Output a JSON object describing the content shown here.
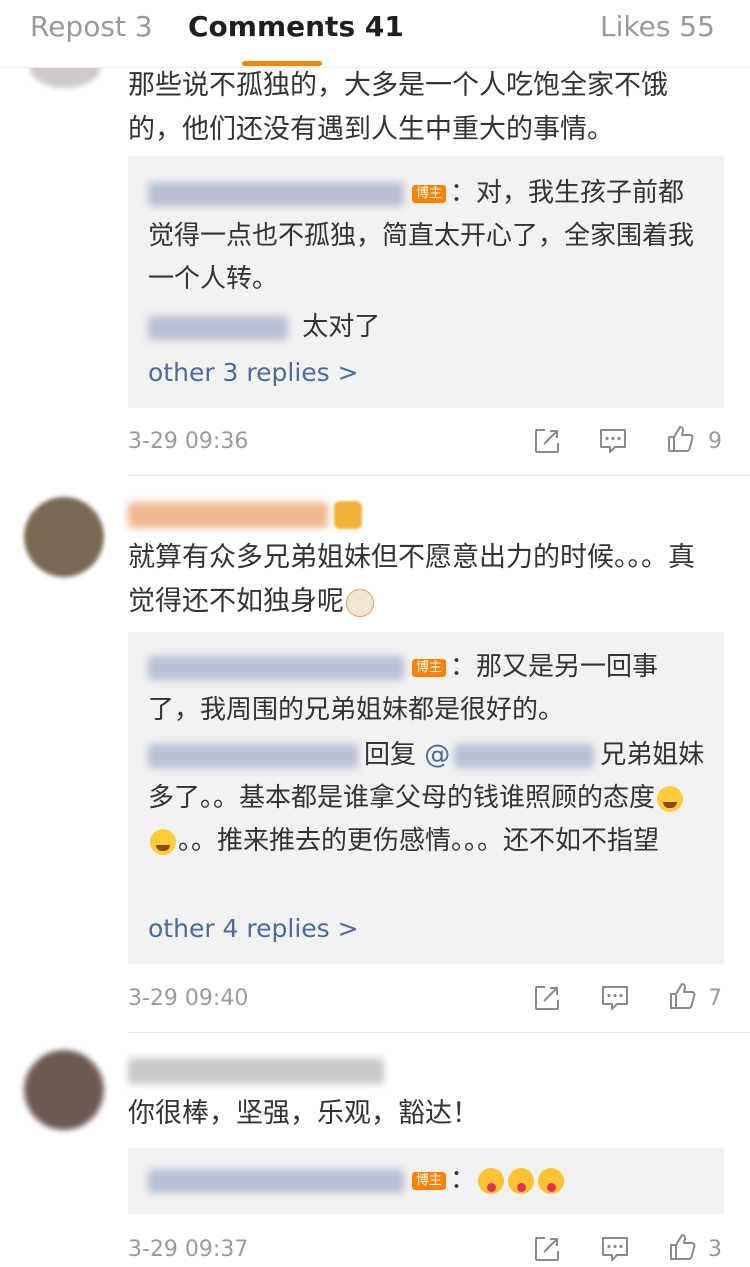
{
  "tabs": {
    "repost": "Repost 3",
    "comments": "Comments 41",
    "likes": "Likes 55"
  },
  "badge_label": "博主",
  "comments": [
    {
      "text": "那些说不孤独的，大多是一个人吃饱全家不饿的，他们还没有遇到人生中重大的事情。",
      "replies": [
        {
          "author_badge": true,
          "text": "：对，我生孩子前都觉得一点也不孤独，简直太开心了，全家围着我一个人转。"
        },
        {
          "author_badge": false,
          "text": "太对了"
        }
      ],
      "more": "other 3 replies >",
      "time": "3-29 09:36",
      "likes": "9"
    },
    {
      "text": "就算有众多兄弟姐妹但不愿意出力的时候。。。真觉得还不如独身呢",
      "replies": [
        {
          "author_badge": true,
          "text": "：那又是另一回事了，我周围的兄弟姐妹都是很好的。"
        },
        {
          "reply_prefix": "回复",
          "mention": "@",
          "text_a": "兄弟姐妹多了。。基本都是谁拿父母的钱谁照顾的态度",
          "text_b": "。。推来推去的更伤感情。。。还不如不指望"
        }
      ],
      "more": "other 4 replies >",
      "time": "3-29 09:40",
      "likes": "7"
    },
    {
      "text": "你很棒，坚强，乐观，豁达！",
      "replies": [
        {
          "author_badge": true,
          "text": "："
        }
      ],
      "time": "3-29 09:37",
      "likes": "3"
    }
  ],
  "icons": {
    "repost": "share-arrow-icon",
    "comment": "comment-bubble-icon",
    "like": "thumbs-up-icon"
  },
  "colors": {
    "accent": "#ff8200",
    "link": "#4a6b9c",
    "muted": "#9a9a9a",
    "reply_bg": "#f2f2f2"
  }
}
